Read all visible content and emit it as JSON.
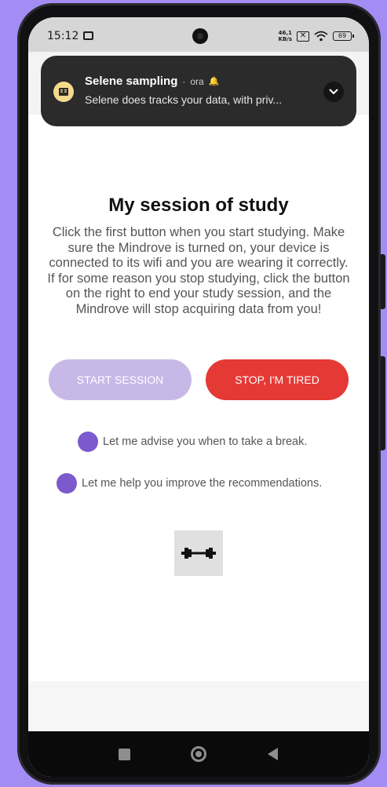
{
  "status_bar": {
    "time": "15:12",
    "net_speed_value": "46,1",
    "net_speed_unit": "KB/s",
    "battery": "69"
  },
  "notification": {
    "app_name": "Selene sampling",
    "separator": "·",
    "time": "ora",
    "body": "Selene does tracks your data, with priv..."
  },
  "main": {
    "title": "My session of study",
    "description": "Click the first button when you start studying. Make sure the Mindrove is turned on, your device is connected to its wifi and you are wearing it correctly. If for some reason you stop studying, click the button on the right to end your study session, and the Mindrove will stop acquiring data from you!",
    "start_button": "START SESSION",
    "stop_button": "STOP, I'M TIRED",
    "option_break": "Let me advise you when to take a break.",
    "option_recommend": "Let me help you improve the recommendations."
  },
  "colors": {
    "background": "#a48cf5",
    "accent": "#7c5acd",
    "start_disabled": "#c8b8e8",
    "stop": "#e53935"
  },
  "icons": {
    "notification": "book-icon",
    "fitness": "dumbbell-icon",
    "nav": [
      "recent-apps-icon",
      "home-icon",
      "back-icon"
    ]
  }
}
